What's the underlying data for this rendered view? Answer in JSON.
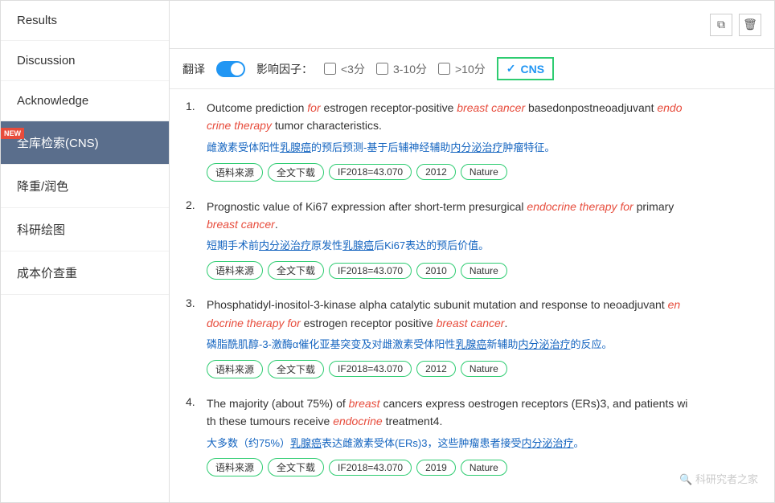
{
  "sidebar": {
    "items": [
      {
        "label": "Results",
        "active": false
      },
      {
        "label": "Discussion",
        "active": false
      },
      {
        "label": "Acknowledge",
        "active": false
      },
      {
        "label": "全库检索(CNS)",
        "active": true,
        "badge": "NEW"
      },
      {
        "label": "降重/润色",
        "active": false
      },
      {
        "label": "科研绘图",
        "active": false
      },
      {
        "label": "成本价查重",
        "active": false
      }
    ]
  },
  "filter": {
    "translate_label": "翻译",
    "impact_label": "影响因子：",
    "opt1": "<3分",
    "opt2": "3-10分",
    "opt3": ">10分",
    "cns_label": "CNS"
  },
  "results": [
    {
      "num": "1.",
      "title_plain": "Outcome prediction for estrogen receptor-positive breast cancer basedonpostneoadjuvant endocrine therapy tumor characteristics.",
      "translation": "雌激素受体阳性乳腺癌的预后预测-基于后辅神经辅助内分泌治疗肿瘤特征。",
      "tags": [
        "语料来源",
        "全文下载",
        "IF2018=43.070",
        "2012",
        "Nature"
      ]
    },
    {
      "num": "2.",
      "title_plain": "Prognostic value of Ki67 expression after short-term presurgical endocrine therapy for primary breast cancer.",
      "translation": "短期手术前内分泌治疗原发性乳腺癌后Ki67表达的预后价值。",
      "tags": [
        "语料来源",
        "全文下载",
        "IF2018=43.070",
        "2010",
        "Nature"
      ]
    },
    {
      "num": "3.",
      "title_plain": "Phosphatidyl-inositol-3-kinase alpha catalytic subunit mutation and response to neoadjuvant endocrine therapy for estrogen receptor positive breast cancer.",
      "translation": "磷脂酰肌醇-3-激酶α催化亚基突变及对雌激素受体阳性乳腺癌新辅助内分泌治疗的反应。",
      "tags": [
        "语料来源",
        "全文下载",
        "IF2018=43.070",
        "2012",
        "Nature"
      ]
    },
    {
      "num": "4.",
      "title_plain": "The majority (about 75%) of breast cancers express oestrogen receptors (ERs)3, and patients with these tumours receive endocrine treatment4.",
      "translation": "大多数（约75%）乳腺癌表达雌激素受体(ERs)3，这些肿瘤患者接受内分泌治疗。",
      "tags": [
        "语料来源",
        "全文下载",
        "IF2018=43.070",
        "2019",
        "Nature"
      ]
    }
  ],
  "watermark": "科研究者之家"
}
